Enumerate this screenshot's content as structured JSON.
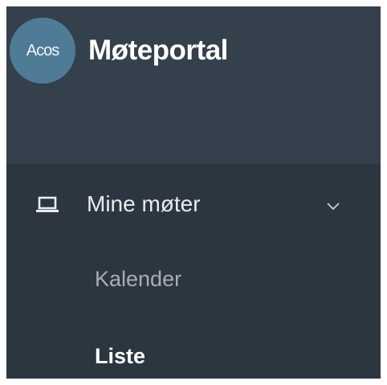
{
  "app": {
    "logo_text": "Acos",
    "title": "Møteportal"
  },
  "menu": {
    "section_label": "Mine møter",
    "section_icon": "laptop-icon",
    "expand_icon": "chevron-down-icon",
    "items": [
      {
        "label": "Kalender",
        "active": false
      },
      {
        "label": "Liste",
        "active": true
      }
    ]
  },
  "colors": {
    "header_bg": "#34404b",
    "menu_bg": "#2c3640",
    "logo_bg": "#4f7b97",
    "active_text": "#ffffff",
    "inactive_text": "#a6adb4"
  }
}
